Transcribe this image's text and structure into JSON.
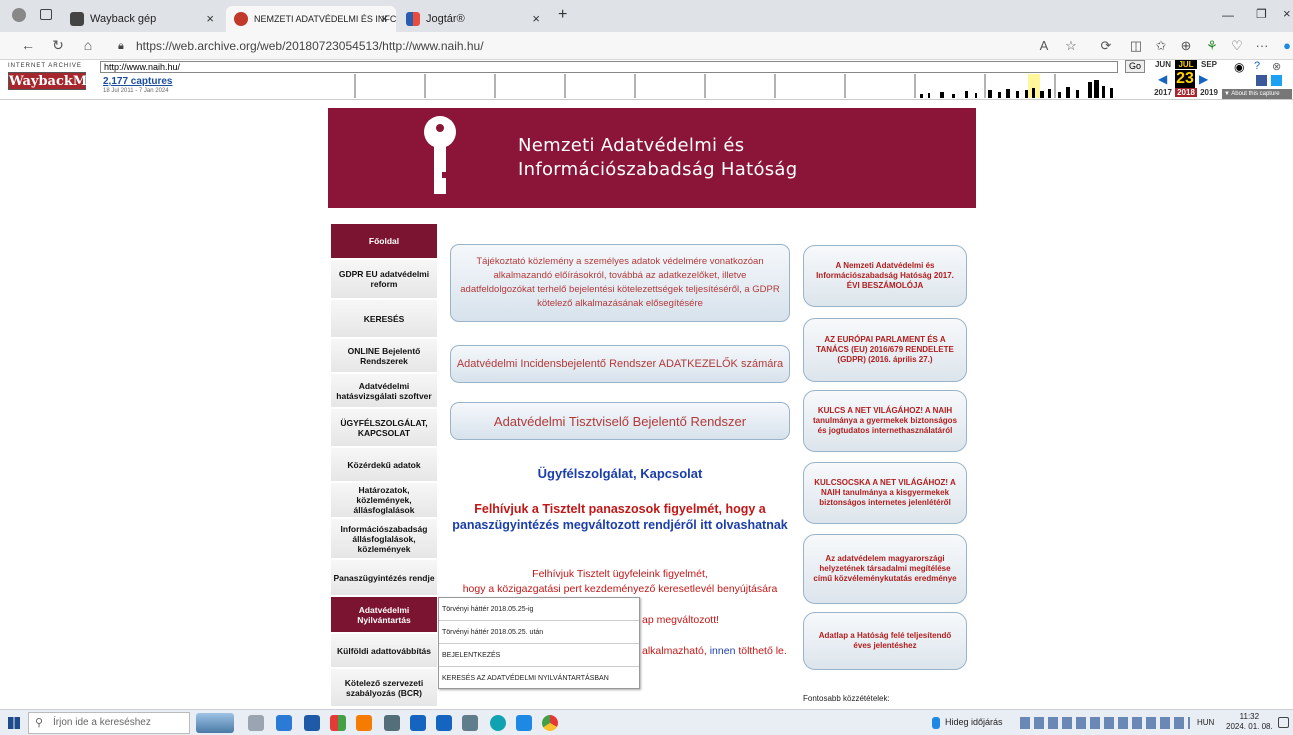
{
  "browser": {
    "tabs": [
      {
        "label": "Wayback gép"
      },
      {
        "label": "NEMZETI ADATVÉDELMI ÉS INFC"
      },
      {
        "label": "Jogtár®"
      }
    ],
    "url": "https://web.archive.org/web/20180723054513/http://www.naih.hu/"
  },
  "wayback": {
    "logo_top": "INTERNET ARCHIVE",
    "logo": "WaybackMachine",
    "url_value": "http://www.naih.hu/",
    "go_label": "Go",
    "captures": "2,177 captures",
    "range": "18 Jul 2011 - 7 Jan 2024",
    "months": [
      "JUN",
      "JUL",
      "SEP"
    ],
    "day": "23",
    "years": [
      "2017",
      "2018",
      "2019"
    ],
    "about": "▼ About this capture"
  },
  "site": {
    "title_line1": "Nemzeti Adatvédelmi és",
    "title_line2": "Információszabadság Hatóság",
    "nav": [
      "Főoldal",
      "GDPR EU adatvédelmi reform",
      "KERESÉS",
      "ONLINE Bejelentő Rendszerek",
      "Adatvédelmi hatásvizsgálati szoftver",
      "ÜGYFÉLSZOLGÁLAT, KAPCSOLAT",
      "Közérdekű adatok",
      "Határozatok, közlemények, állásfoglalások",
      "Információszabadság állásfoglalások, közlemények",
      "Panaszügyintézés rendje",
      "Adatvédelmi Nyilvántartás",
      "Külföldi adattovábbítás",
      "Kötelező szervezeti szabályozás (BCR)"
    ],
    "main_buttons": [
      "Tájékoztató közlemény a személyes adatok védelmére vonatkozóan alkalmazandó előírásokról, továbbá az adatkezelőket, illetve adatfeldolgozókat terhelő bejelentési kötelezettségek teljesítéséről, a GDPR kötelező alkalmazásának elősegítésére",
      "Adatvédelmi Incidensbejelentő Rendszer ADATKEZELŐK számára",
      "Adatvédelmi Tisztviselő Bejelentő Rendszer"
    ],
    "ugyfelszolgalat": "Ügyfélszolgálat, Kapcsolat",
    "notice1_line1": "Felhívjuk a Tisztelt panaszosok figyelmét, hogy a",
    "notice1_line2": "panaszügyintézés megváltozott rendjéről itt olvashatnak",
    "notice2_line1": "Felhívjuk Tisztelt ügyfeleink figyelmét,",
    "notice2_line2": "hogy a közigazgatási pert kezdeményező keresetlevél benyújtására",
    "partial1": "ap megváltozott!",
    "partial2_a": "alkalmazható,",
    "partial2_link": "innen",
    "partial2_b": "tölthető le.",
    "dropdown": [
      "Törvényi háttér 2018.05.25-ig",
      "Törvényi háttér 2018.05.25. után",
      "BEJELENTKEZÉS",
      "KERESÉS AZ ADATVÉDELMI NYILVÁNTARTÁSBAN"
    ],
    "side_buttons": [
      "A Nemzeti Adatvédelmi és Információszabadság Hatóság 2017. ÉVI BESZÁMOLÓJA",
      "AZ EURÓPAI PARLAMENT ÉS A TANÁCS (EU) 2016/679 RENDELETE (GDPR) (2016. április 27.)",
      "KULCS A NET VILÁGÁHOZ! A NAIH tanulmánya a gyermekek biztonságos és jogtudatos internethasználatáról",
      "KULCSOCSKA A NET VILÁGÁHOZ! A NAIH tanulmánya a kisgyermekek biztonságos internetes jelenlétéről",
      "Az adatvédelem magyarországi helyzetének társadalmi megítélése című közvéleménykutatás eredménye",
      "Adatlap a Hatóság felé teljesítendő éves jelentéshez"
    ],
    "fontosabb": "Fontosabb közzétételek:"
  },
  "taskbar": {
    "search_placeholder": "Írjon ide a kereséshez",
    "weather": "Hideg időjárás",
    "lang": "HUN",
    "time": "11:32",
    "date": "2024. 01. 08."
  },
  "colors": {
    "brand": "#8a1538",
    "link_blue": "#1b3fa8",
    "notice_red": "#c01818"
  }
}
